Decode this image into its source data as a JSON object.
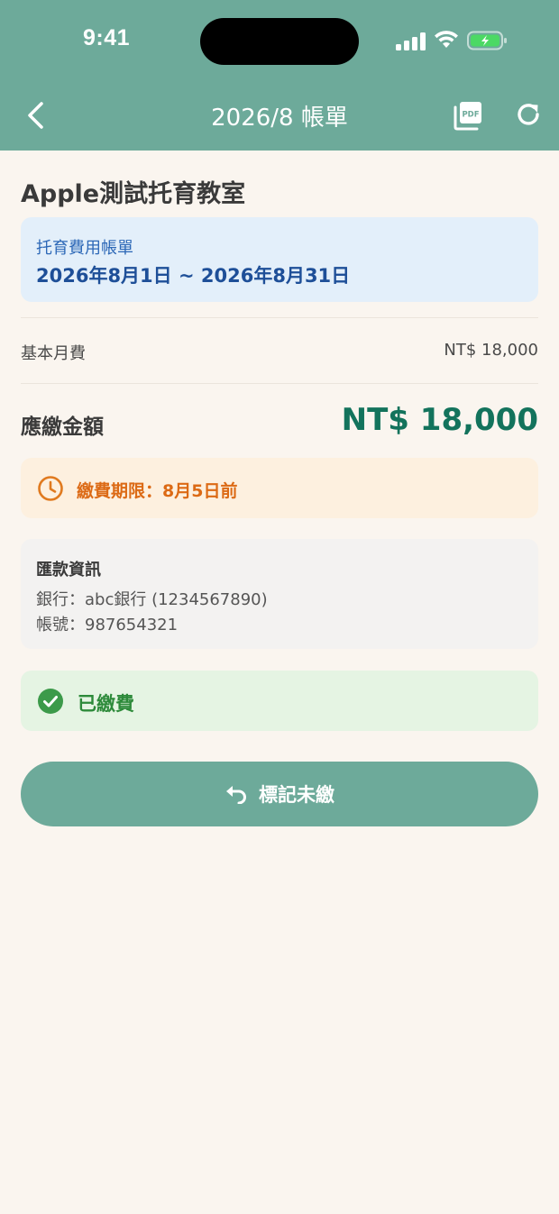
{
  "status_bar": {
    "time": "9:41"
  },
  "nav": {
    "title": "2026/8 帳單",
    "pdf_icon_text": "PDF"
  },
  "school_name": "Apple測試托育教室",
  "period": {
    "label": "托育費用帳單",
    "range": "2026年8月1日 ~ 2026年8月31日"
  },
  "fees": {
    "base_label": "基本月費",
    "base_value": "NT$ 18,000"
  },
  "total": {
    "label": "應繳金額",
    "value": "NT$ 18,000"
  },
  "deadline": {
    "text": "繳費期限：8月5日前"
  },
  "bank": {
    "title": "匯款資訊",
    "bank_line": "銀行：abc銀行 (1234567890)",
    "account_line": "帳號：987654321"
  },
  "status": {
    "paid_label": "已繳費"
  },
  "action": {
    "mark_unpaid_label": "標記未繳"
  },
  "colors": {
    "header": "#6daa9a",
    "background": "#faf5ef",
    "total_amount": "#13735c",
    "deadline_text": "#dc6a15",
    "paid_text": "#2d8a3a",
    "period_text": "#1e4f98"
  },
  "icons": {
    "back": "chevron-left-icon",
    "pdf": "pdf-icon",
    "refresh": "refresh-icon",
    "deadline": "clock-icon",
    "paid": "check-circle-icon",
    "undo": "undo-icon"
  }
}
